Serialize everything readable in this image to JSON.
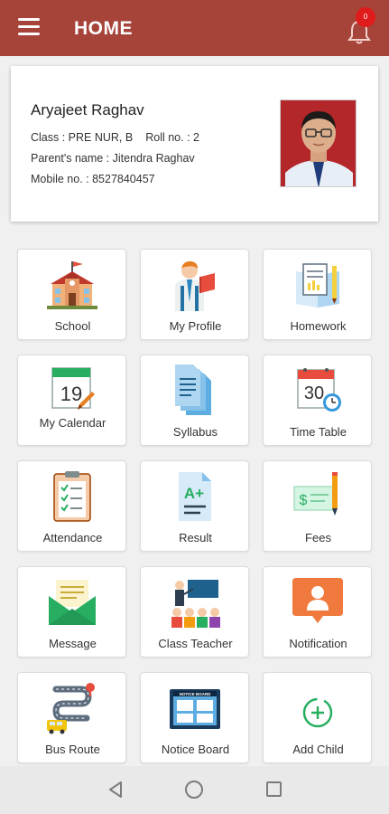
{
  "app_bar": {
    "title": "HOME",
    "notification_count": "0",
    "color": "#a6443a"
  },
  "profile": {
    "name": "Aryajeet Raghav",
    "class_line": "Class : PRE NUR, B",
    "roll_line": "Roll no. : 2",
    "parent_line": "Parent's name : Jitendra Raghav",
    "mobile_line": "Mobile no. : 8527840457"
  },
  "tiles": [
    {
      "label": "School",
      "icon": "school-icon"
    },
    {
      "label": "My Profile",
      "icon": "profile-icon"
    },
    {
      "label": "Homework",
      "icon": "homework-icon"
    },
    {
      "label": "My Calendar",
      "icon": "calendar-icon",
      "calendar_day": "19"
    },
    {
      "label": "Syllabus",
      "icon": "syllabus-icon"
    },
    {
      "label": "Time Table",
      "icon": "timetable-icon",
      "calendar_day": "30"
    },
    {
      "label": "Attendance",
      "icon": "attendance-icon"
    },
    {
      "label": "Result",
      "icon": "result-icon",
      "grade": "A+"
    },
    {
      "label": "Fees",
      "icon": "fees-icon"
    },
    {
      "label": "Message",
      "icon": "message-icon"
    },
    {
      "label": "Class Teacher",
      "icon": "class-teacher-icon"
    },
    {
      "label": "Notification",
      "icon": "notification-icon"
    },
    {
      "label": "Bus Route",
      "icon": "bus-route-icon"
    },
    {
      "label": "Notice Board",
      "icon": "notice-board-icon",
      "board_text": "NOTICE BOARD"
    },
    {
      "label": "Add Child",
      "icon": "add-child-icon"
    }
  ]
}
